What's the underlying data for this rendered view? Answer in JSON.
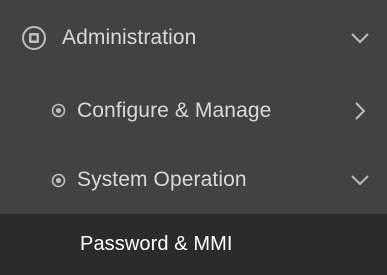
{
  "menu": {
    "items": [
      {
        "label": "Administration",
        "icon": "admin-icon",
        "expanded": true,
        "chevron": "chevron-down-icon"
      },
      {
        "label": "Configure & Manage",
        "icon": "radio-icon",
        "expanded": false,
        "chevron": "chevron-right-icon"
      },
      {
        "label": "System Operation",
        "icon": "radio-icon",
        "expanded": true,
        "chevron": "chevron-down-icon"
      },
      {
        "label": "Password & MMI",
        "active": true
      }
    ]
  },
  "colors": {
    "background": "#424242",
    "active_background": "#2b2b2b",
    "text": "#d9d9d9",
    "active_text": "#ffffff",
    "icon": "#bdbdbd"
  }
}
